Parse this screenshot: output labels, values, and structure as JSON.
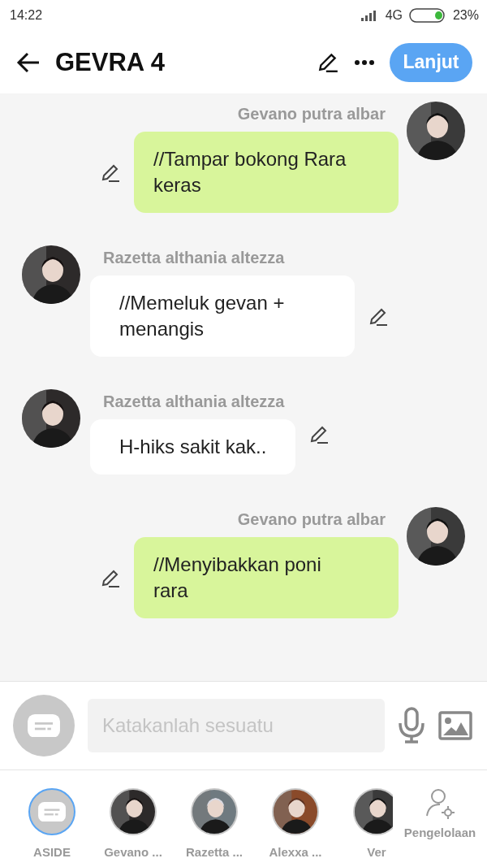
{
  "status_bar": {
    "time": "14:22",
    "network": "4G",
    "battery": "23%"
  },
  "header": {
    "title": "GEVRA 4",
    "action": "Lanjut"
  },
  "messages": [
    {
      "kind": "outgoing",
      "sender": "Gevano putra albar",
      "text": "//Tampar bokong Rara keras"
    },
    {
      "kind": "incoming",
      "sender": "Razetta althania altezza",
      "text": "//Memeluk gevan + menangis"
    },
    {
      "kind": "incoming",
      "sender": "Razetta althania altezza",
      "text": "H-hiks sakit kak.."
    },
    {
      "kind": "outgoing",
      "sender": "Gevano putra albar",
      "text": "//Menyibakkan poni rara"
    }
  ],
  "composer": {
    "placeholder": "Katakanlah sesuatu"
  },
  "characters": [
    {
      "kind": "aside",
      "name": "ASIDE",
      "selected": true
    },
    {
      "kind": "picture",
      "name": "Gevano ...",
      "selected": false
    },
    {
      "kind": "picture",
      "name": "Razetta ...",
      "selected": false
    },
    {
      "kind": "picture",
      "name": "Alexxa ...",
      "selected": false
    },
    {
      "kind": "picture",
      "name": "Ver",
      "selected": false
    }
  ],
  "manage": {
    "label": "Pengelolaan"
  }
}
